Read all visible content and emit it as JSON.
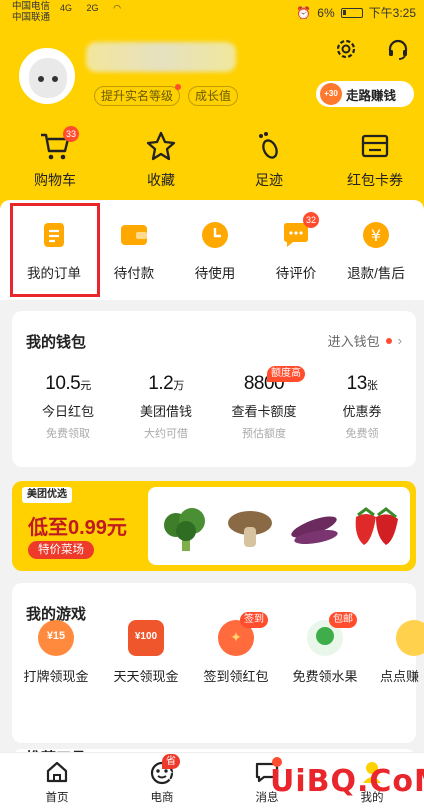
{
  "status_bar": {
    "carrier1": "中国电信",
    "carrier2": "中国联通",
    "signal1": "4G",
    "signal2": "2G",
    "battery": "6%",
    "time": "下午3:25"
  },
  "profile": {
    "chip_verify": "提升实名等级",
    "chip_growth": "成长值",
    "earn_label": "走路赚钱",
    "earn_badge": "+30"
  },
  "quick": [
    {
      "label": "购物车",
      "badge": "33",
      "icon": "cart-icon"
    },
    {
      "label": "收藏",
      "icon": "star-icon"
    },
    {
      "label": "足迹",
      "icon": "footprint-icon"
    },
    {
      "label": "红包卡券",
      "icon": "wallet-card-icon"
    }
  ],
  "orders": [
    {
      "label": "我的订单",
      "icon": "order-list-icon"
    },
    {
      "label": "待付款",
      "icon": "wallet-pay-icon"
    },
    {
      "label": "待使用",
      "icon": "clock-icon"
    },
    {
      "label": "待评价",
      "icon": "comment-icon",
      "badge": "32"
    },
    {
      "label": "退款/售后",
      "icon": "refund-icon"
    }
  ],
  "wallet": {
    "title": "我的钱包",
    "link": "进入钱包",
    "tag_high": "额度高",
    "stats": [
      {
        "value": "10.5",
        "unit": "元",
        "label": "今日红包",
        "sub": "免费领取"
      },
      {
        "value": "1.2",
        "unit": "万",
        "label": "美团借钱",
        "sub": "大约可借"
      },
      {
        "value": "8800",
        "unit": "",
        "label": "查看卡额度",
        "sub": "预估额度"
      },
      {
        "value": "13",
        "unit": "张",
        "label": "优惠券",
        "sub": "免费领"
      }
    ]
  },
  "promo": {
    "brand": "美团优选",
    "price": "低至0.99元",
    "button": "特价菜场"
  },
  "games": {
    "title": "我的游戏",
    "items": [
      {
        "label": "打牌领现金",
        "icon_text": "¥15"
      },
      {
        "label": "天天领现金",
        "icon_text": "¥100"
      },
      {
        "label": "签到领红包",
        "tag": "签到"
      },
      {
        "label": "免费领水果",
        "tag": "包邮"
      },
      {
        "label": "点点赚"
      }
    ]
  },
  "next_section_title": "推荐工具",
  "tabbar": [
    {
      "label": "首页",
      "icon": "home-icon"
    },
    {
      "label": "电商",
      "icon": "shop-icon",
      "tag": "省心"
    },
    {
      "label": "消息",
      "icon": "message-icon"
    },
    {
      "label": "我的",
      "icon": "profile-icon"
    }
  ],
  "watermark": "UiBQ.CoM",
  "colors": {
    "brand_yellow": "#ffd100",
    "accent_red": "#ff4d2e",
    "highlight_border": "#e8262c"
  }
}
